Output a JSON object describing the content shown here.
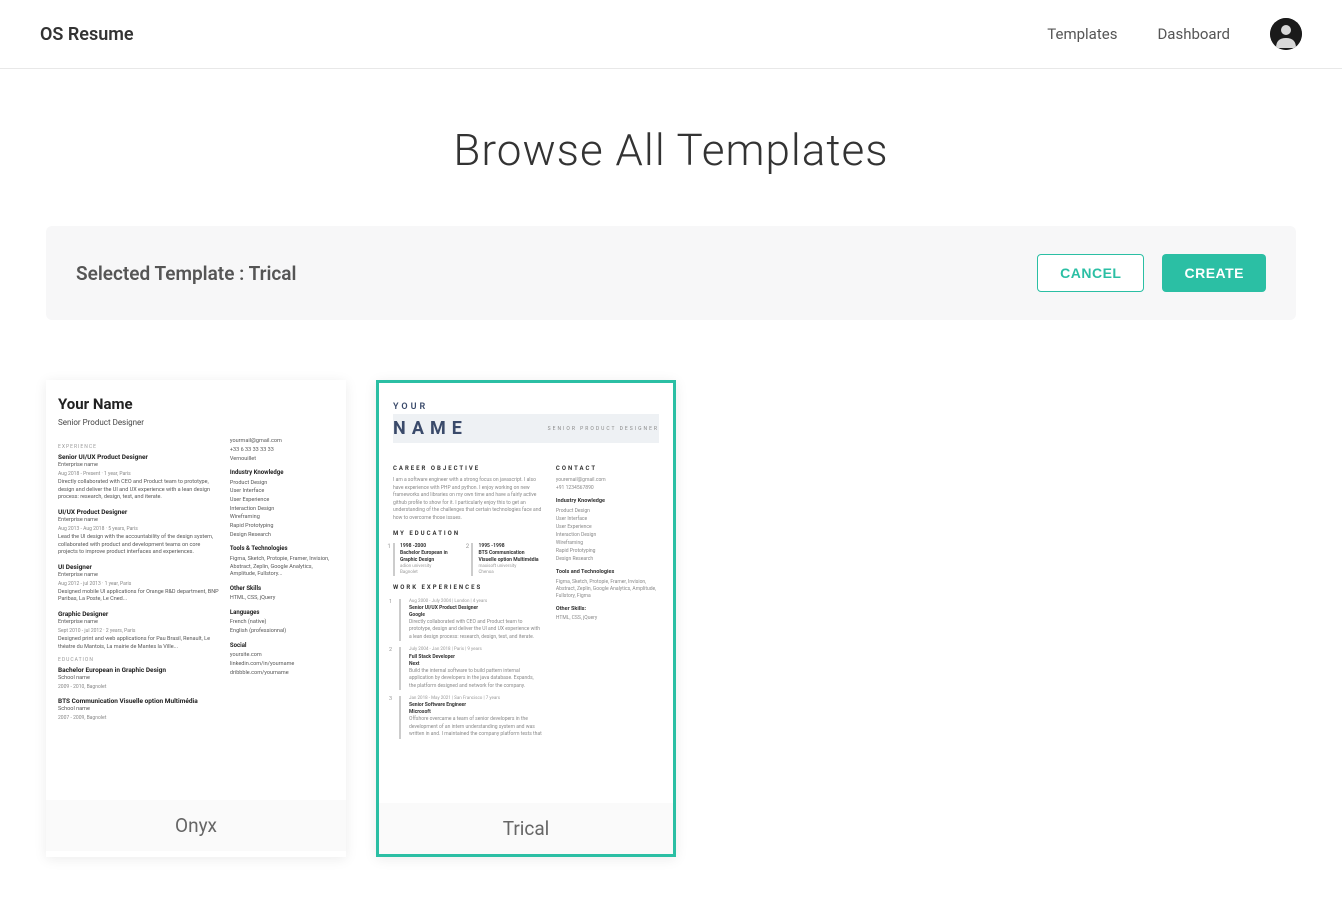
{
  "header": {
    "logo": "OS Resume",
    "nav": {
      "templates": "Templates",
      "dashboard": "Dashboard"
    }
  },
  "page": {
    "title": "Browse All Templates"
  },
  "selection": {
    "label": "Selected Template : Trical",
    "cancel": "CANCEL",
    "create": "CREATE"
  },
  "templates": [
    {
      "name": "Onyx",
      "selected": false,
      "preview": {
        "name": "Your Name",
        "subtitle": "Senior Product Designer",
        "left": {
          "section_experience": "EXPERIENCE",
          "jobs": [
            {
              "title": "Senior UI/UX Product Designer",
              "company": "Enterprise name",
              "dates": "Aug 2018 - Present · 1 year, Paris",
              "desc": "Directly collaborated with CEO and Product team to prototype, design and deliver the UI and UX experience with a lean design process: research, design, test, and iterate."
            },
            {
              "title": "UI/UX Product Designer",
              "company": "Enterprise name",
              "dates": "Aug 2013 - Aug 2018 · 5 years, Paris",
              "desc": "Lead the UI design with the accountability of the design system, collaborated with product and development teams on core projects to improve product interfaces and experiences."
            },
            {
              "title": "UI Designer",
              "company": "Enterprise name",
              "dates": "Aug 2012 - jul 2013 · 1 year, Paris",
              "desc": "Designed mobile UI applications for Orange R&D department, BNP Paribas, La Poste, Le Cned..."
            },
            {
              "title": "Graphic Designer",
              "company": "Enterprise name",
              "dates": "Sept 2010 - jul 2012 · 2 years, Paris",
              "desc": "Designed print and web applications for Pau Brasil, Renault, Le théatre du Mantois, La mairie de Mantes la Ville..."
            }
          ],
          "section_education": "EDUCATION",
          "education": [
            {
              "title": "Bachelor European in Graphic Design",
              "school": "School name",
              "dates": "2009 - 2010, Bagnolet"
            },
            {
              "title": "BTS Communication Visuelle option Multimédia",
              "school": "School name",
              "dates": "2007 - 2009, Bagnolet"
            }
          ]
        },
        "right": {
          "contact": [
            "yourmail@gmail.com",
            "+33 6 33 33 33 33",
            "Vernouillet"
          ],
          "industry_head": "Industry Knowledge",
          "industry": [
            "Product Design",
            "User Interface",
            "User Experience",
            "Interaction Design",
            "Wireframing",
            "Rapid Prototyping",
            "Design Research"
          ],
          "tools_head": "Tools & Technologies",
          "tools": "Figma, Sketch, Protopie, Framer, Invision, Abstract, Zeplin, Google Analytics, Amplitude, Fullstory...",
          "other_head": "Other Skills",
          "other": "HTML, CSS, jQuery",
          "lang_head": "Languages",
          "lang": [
            "French (native)",
            "English (professionnal)"
          ],
          "social_head": "Social",
          "social": [
            "yoursite.com",
            "linkedin.com/in/yourname",
            "dribbble.com/yourname"
          ]
        }
      }
    },
    {
      "name": "Trical",
      "selected": true,
      "preview": {
        "name1": "YOUR",
        "name2": "NAME",
        "role": "SENIOR PRODUCT DESIGNER",
        "left": {
          "objective_head": "CAREER OBJECTIVE",
          "objective": "I am a software engineer with a strong focus on javascript. I also have experience with PHP and python. I enjoy working on new frameworks and libraries on my own time and have a fairly active github profile to show for it. I particularly enjoy this to get an understanding of the challenges that certain technologies face and how to overcome those issues.",
          "education_head": "MY EDUCATION",
          "education": [
            {
              "num": "1",
              "dates": "1998 -2000",
              "title": "Bachelor European in Graphic Design",
              "school": "adion university",
              "city": "Bagnolet"
            },
            {
              "num": "2",
              "dates": "1995 -1998",
              "title": "BTS Communication Visuelle option Multimédia",
              "school": "maxisoft university",
              "city": "Chenoa"
            }
          ],
          "work_head": "WORK EXPERIENCES",
          "work": [
            {
              "num": "1",
              "dates": "Aug 2000 - July 2004 | London | 4 years",
              "title": "Senior UI/UX Product Designer",
              "company": "Google",
              "desc": "Directly collaborated with CEO and Product team to prototype, design and deliver the UI and UX experience with a lean design process: research, design, test, and iterate."
            },
            {
              "num": "2",
              "dates": "July 2004 - Jan 2018 | Paris | 9 years",
              "title": "Full Stack Developer",
              "company": "Next",
              "desc": "Build the internal software to build pattern internal application by developers in the java database. Expands, the platform designed and network for the company."
            },
            {
              "num": "3",
              "dates": "Jan 2018 - May 2021 | San Francisco | 7 years",
              "title": "Senior Software Engineer",
              "company": "Microsoft",
              "desc": "Offshore overcame a team of senior developers in the development of an intern understanding system and was written in and. I maintained the company platform tests that"
            }
          ]
        },
        "right": {
          "contact_head": "CONTACT",
          "contact": [
            "youremail@gmail.com",
            "+91 1234567890"
          ],
          "industry_head": "Industry Knowledge",
          "industry": [
            "Product Design",
            "User Interface",
            "User Experience",
            "Interaction Design",
            "Wireframing",
            "Rapid Prototyping",
            "Design Research"
          ],
          "tools_head": "Tools and Technologies",
          "tools": "Figma, Sketch, Protopie, Framer, Invision, Abstract, Zeplin, Google Analytics, Amplitude, Fullstory, Figma",
          "other_head": "Other Skills:",
          "other": "HTML, CSS, jQuery"
        }
      }
    }
  ]
}
